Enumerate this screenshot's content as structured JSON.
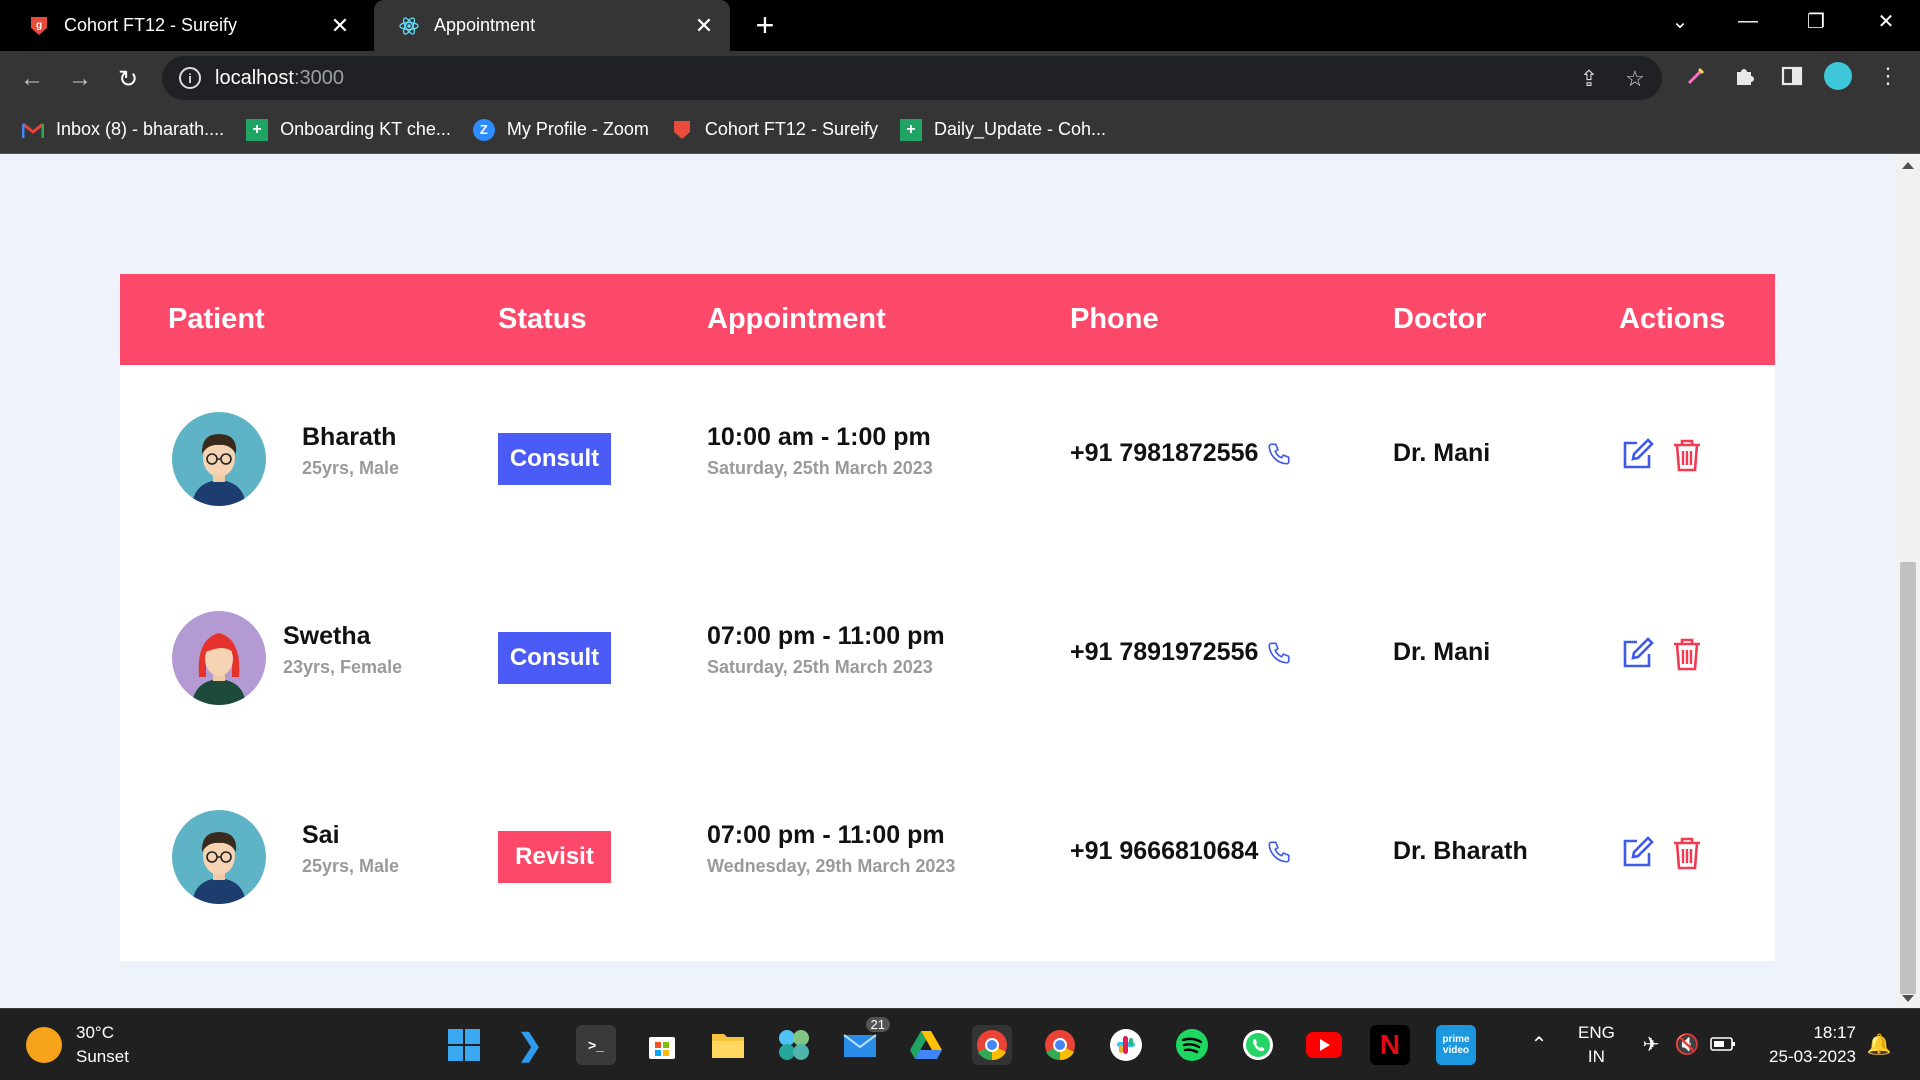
{
  "browser": {
    "tabs": [
      {
        "title": "Cohort FT12 - Sureify",
        "active": false
      },
      {
        "title": "Appointment",
        "active": true
      }
    ],
    "url_host": "localhost",
    "url_port": ":3000",
    "bookmarks": [
      {
        "label": "Inbox (8) - bharath....",
        "icon": "gmail-icon"
      },
      {
        "label": "Onboarding KT che...",
        "icon": "sheets-icon"
      },
      {
        "label": "My Profile - Zoom",
        "icon": "zoom-icon"
      },
      {
        "label": "Cohort FT12 - Sureify",
        "icon": "sureify-icon"
      },
      {
        "label": "Daily_Update - Coh...",
        "icon": "sheets-icon"
      }
    ]
  },
  "table": {
    "headers": {
      "patient": "Patient",
      "status": "Status",
      "appointment": "Appointment",
      "phone": "Phone",
      "doctor": "Doctor",
      "actions": "Actions"
    },
    "rows": [
      {
        "name": "Bharath",
        "info": "25yrs, Male",
        "status": "Consult",
        "time": "10:00 am - 1:00 pm",
        "date": "Saturday, 25th March 2023",
        "phone": "+91 7981872556",
        "doctor": "Dr. Mani"
      },
      {
        "name": "Swetha",
        "info": "23yrs, Female",
        "status": "Consult",
        "time": "07:00 pm - 11:00 pm",
        "date": "Saturday, 25th March 2023",
        "phone": "+91 7891972556",
        "doctor": "Dr. Mani"
      },
      {
        "name": "Sai",
        "info": "25yrs, Male",
        "status": "Revisit",
        "time": "07:00 pm - 11:00 pm",
        "date": "Wednesday, 29th March 2023",
        "phone": "+91 9666810684",
        "doctor": "Dr. Bharath"
      }
    ]
  },
  "colors": {
    "header_bg": "#fc4869",
    "consult": "#4a5cf5",
    "revisit": "#fc4869",
    "edit_icon": "#3f5ae8",
    "delete_icon": "#f23a52"
  },
  "taskbar": {
    "weather_temp": "30°C",
    "weather_desc": "Sunset",
    "mail_badge": "21",
    "lang": "ENG",
    "region": "IN",
    "time": "18:17",
    "date": "25-03-2023"
  }
}
